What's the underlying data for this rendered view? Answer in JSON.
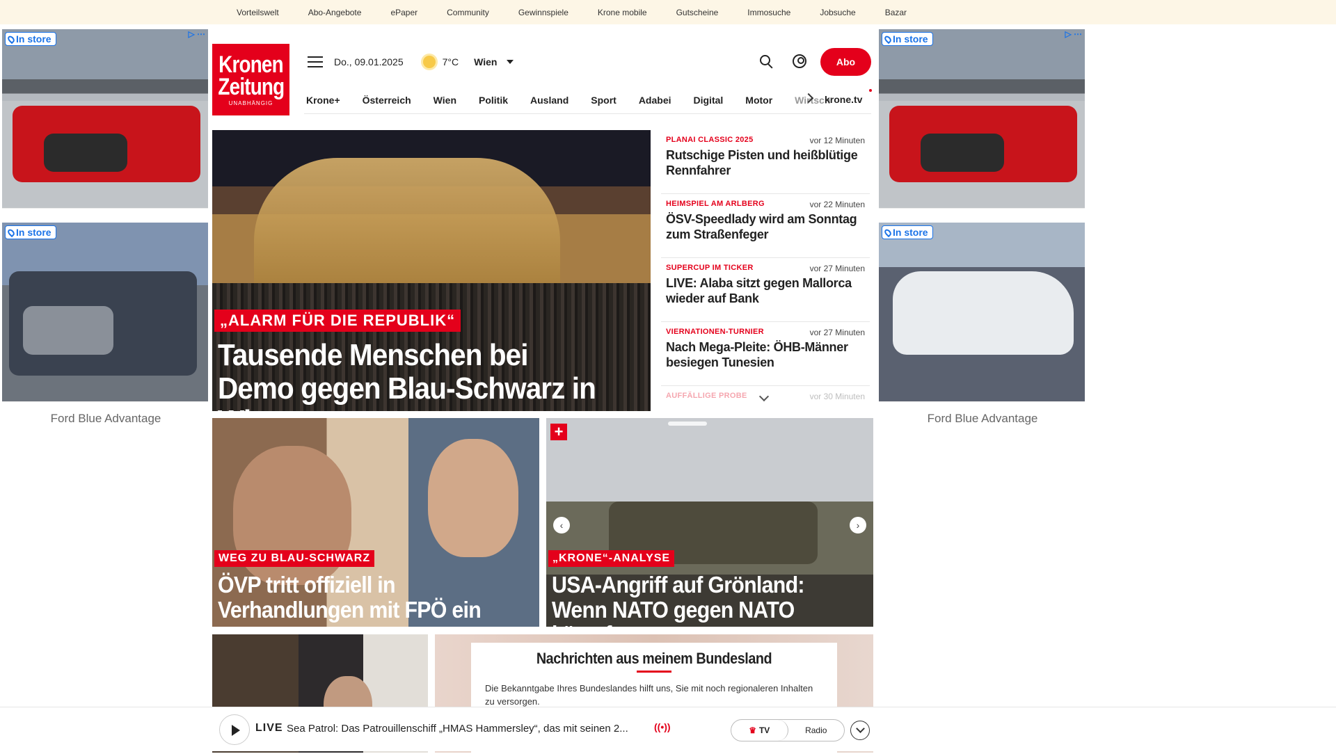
{
  "topbar": {
    "links": [
      "Vorteilswelt",
      "Abo-Angebote",
      "ePaper",
      "Community",
      "Gewinnspiele",
      "Krone mobile",
      "Gutscheine",
      "Immosuche",
      "Jobsuche",
      "Bazar"
    ]
  },
  "ads": {
    "badge": "In store",
    "caption": "Ford Blue Advantage"
  },
  "logo": {
    "line1": "Kronen",
    "line2": "Zeitung",
    "line3": "UNABHÄNGIG"
  },
  "header": {
    "date": "Do., 09.01.2025",
    "temperature": "7°C",
    "city": "Wien",
    "abo_label": "Abo"
  },
  "nav": {
    "items": [
      "Krone+",
      "Österreich",
      "Wien",
      "Politik",
      "Ausland",
      "Sport",
      "Adabei",
      "Digital",
      "Motor"
    ],
    "faded": "Wirtsch",
    "tv": "krone.tv"
  },
  "hero": {
    "kicker": "„ALARM FÜR DIE REPUBLIK“",
    "title": "Tausende Menschen bei Demo gegen Blau-Schwarz in Wien"
  },
  "ticker": [
    {
      "kicker": "PLANAI CLASSIC 2025",
      "time": "vor 12 Minuten",
      "title": "Rutschige Pisten und heißblütige Rennfahrer"
    },
    {
      "kicker": "HEIMSPIEL AM ARLBERG",
      "time": "vor 22 Minuten",
      "title": "ÖSV-Speedlady wird am Sonntag zum Straßenfeger"
    },
    {
      "kicker": "SUPERCUP IM TICKER",
      "time": "vor 27 Minuten",
      "title": "LIVE: Alaba sitzt gegen Mallorca wieder auf Bank"
    },
    {
      "kicker": "VIERNATIONEN-TURNIER",
      "time": "vor 27 Minuten",
      "title": "Nach Mega-Pleite: ÖHB-Männer besiegen Tunesien"
    },
    {
      "kicker": "AUFFÄLLIGE PROBE",
      "time": "vor 30 Minuten",
      "title": ""
    }
  ],
  "cards": [
    {
      "kicker": "WEG ZU BLAU-SCHWARZ",
      "title": "ÖVP tritt offiziell in Verhandlungen mit FPÖ ein"
    },
    {
      "kicker": "„KRONE“-ANALYSE",
      "title": "USA-Angriff auf Grönland: Wenn NATO gegen NATO kämpft",
      "plus": "+"
    }
  ],
  "bundesland": {
    "title": "Nachrichten aus meinem Bundesland",
    "text": "Die Bekanntgabe Ihres Bundeslandes hilft uns, Sie mit noch regionaleren Inhalten zu versorgen."
  },
  "player": {
    "live_label": "LIVE",
    "text": "Sea Patrol: Das Patrouillenschiff „HMAS Hammersley“, das mit seinen 2...",
    "tv_label": "TV",
    "radio_label": "Radio"
  }
}
